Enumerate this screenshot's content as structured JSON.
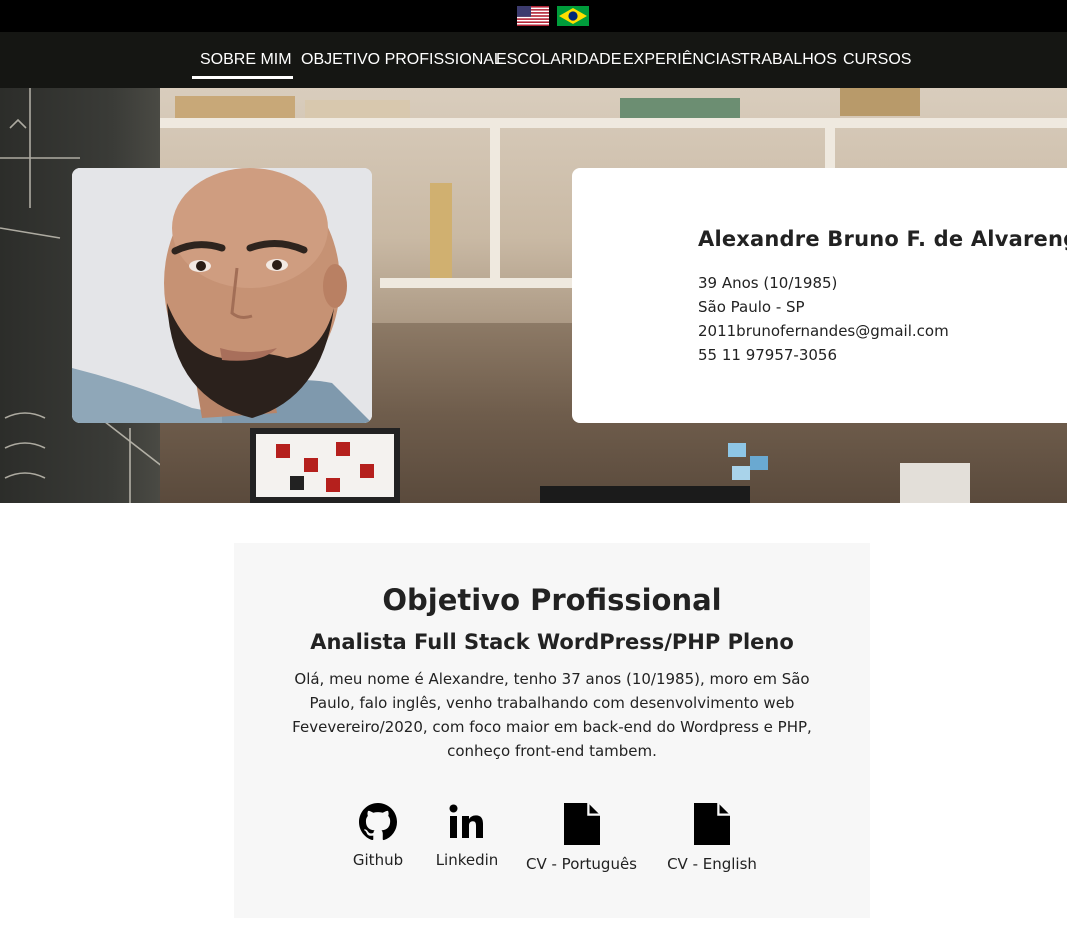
{
  "language_bar": {
    "flags": [
      {
        "icon": "us-flag-icon",
        "label": "English"
      },
      {
        "icon": "brazil-flag-icon",
        "label": "Português"
      }
    ]
  },
  "nav": {
    "items": [
      "SOBRE MIM",
      "OBJETIVO PROFISSIONAL",
      "ESCOLARIDADE",
      "EXPERIÊNCIAS",
      "TRABALHOS",
      "CURSOS"
    ],
    "active": "SOBRE MIM"
  },
  "profile": {
    "name": "Alexandre Bruno F. de Alvarenga",
    "age": "39 Anos (10/1985)",
    "location": "São Paulo - SP",
    "email": "2011brunofernandes@gmail.com",
    "phone": "55 11 97957-3056"
  },
  "objective": {
    "title": "Objetivo Profissional",
    "subtitle": "Analista Full Stack WordPress/PHP Pleno",
    "text": "Olá, meu nome é Alexandre, tenho 37 anos (10/1985), moro em São Paulo, falo inglês, venho trabalhando com desenvolvimento web Fevevereiro/2020, com foco maior em back-end do Wordpress e PHP, conheço front-end tambem."
  },
  "links": [
    {
      "icon": "github-icon",
      "label": "Github"
    },
    {
      "icon": "linkedin-icon",
      "label": "Linkedin"
    },
    {
      "icon": "document-icon",
      "label": "CV - Português"
    },
    {
      "icon": "document-icon",
      "label": "CV - English"
    }
  ],
  "colors": {
    "topbar": "#000000",
    "nav": "#151613",
    "section_bg": "#f7f7f7",
    "text": "#222222"
  }
}
